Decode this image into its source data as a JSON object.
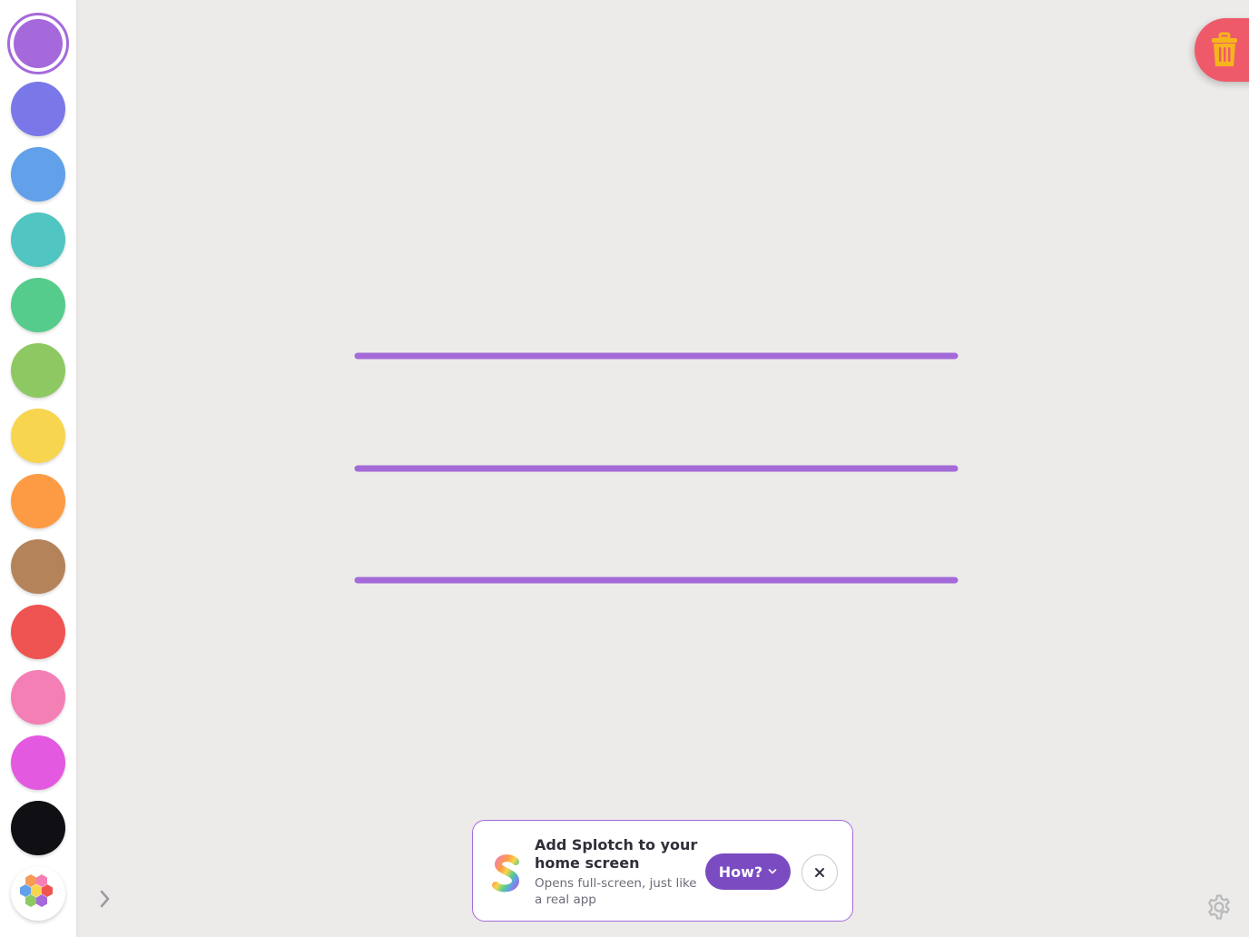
{
  "palette": {
    "colors": [
      {
        "name": "purple",
        "hex": "#a569db",
        "selected": true
      },
      {
        "name": "indigo",
        "hex": "#7a78e8"
      },
      {
        "name": "blue",
        "hex": "#62a0ea"
      },
      {
        "name": "teal",
        "hex": "#50c5c1"
      },
      {
        "name": "green",
        "hex": "#55cc8c"
      },
      {
        "name": "lime",
        "hex": "#8ec863"
      },
      {
        "name": "yellow",
        "hex": "#f7d54f"
      },
      {
        "name": "orange",
        "hex": "#fd9b44"
      },
      {
        "name": "brown",
        "hex": "#b5835a"
      },
      {
        "name": "red",
        "hex": "#ee5452"
      },
      {
        "name": "pink",
        "hex": "#f47fb5"
      },
      {
        "name": "magenta",
        "hex": "#e35ae0"
      },
      {
        "name": "black",
        "hex": "#0f0f14"
      }
    ],
    "multicolor_icon": "hexagon-rainbow-icon"
  },
  "canvas": {
    "stroke_color": "#a46ad8",
    "stroke_count": 3
  },
  "trash": {
    "icon": "trash-icon",
    "color": "#ef5a6a",
    "icon_color": "#f6b51e"
  },
  "expand": {
    "icon": "chevron-right-icon"
  },
  "settings": {
    "icon": "gear-icon"
  },
  "banner": {
    "title": "Add Splotch to your home screen",
    "subtitle": "Opens full-screen, just like a real app",
    "how_label": "How?",
    "accent": "#7b4bc1"
  }
}
